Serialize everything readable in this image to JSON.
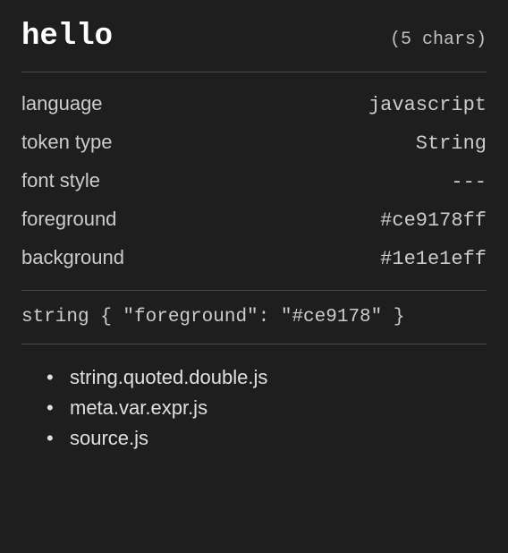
{
  "header": {
    "token_text": "hello",
    "char_count": "(5 chars)"
  },
  "properties": {
    "language_label": "language",
    "language_value": "javascript",
    "token_type_label": "token type",
    "token_type_value": "String",
    "font_style_label": "font style",
    "font_style_value": "---",
    "foreground_label": "foreground",
    "foreground_value": "#ce9178ff",
    "background_label": "background",
    "background_value": "#1e1e1eff"
  },
  "rule": "string { \"foreground\": \"#ce9178\" }",
  "scopes": [
    "string.quoted.double.js",
    "meta.var.expr.js",
    "source.js"
  ]
}
